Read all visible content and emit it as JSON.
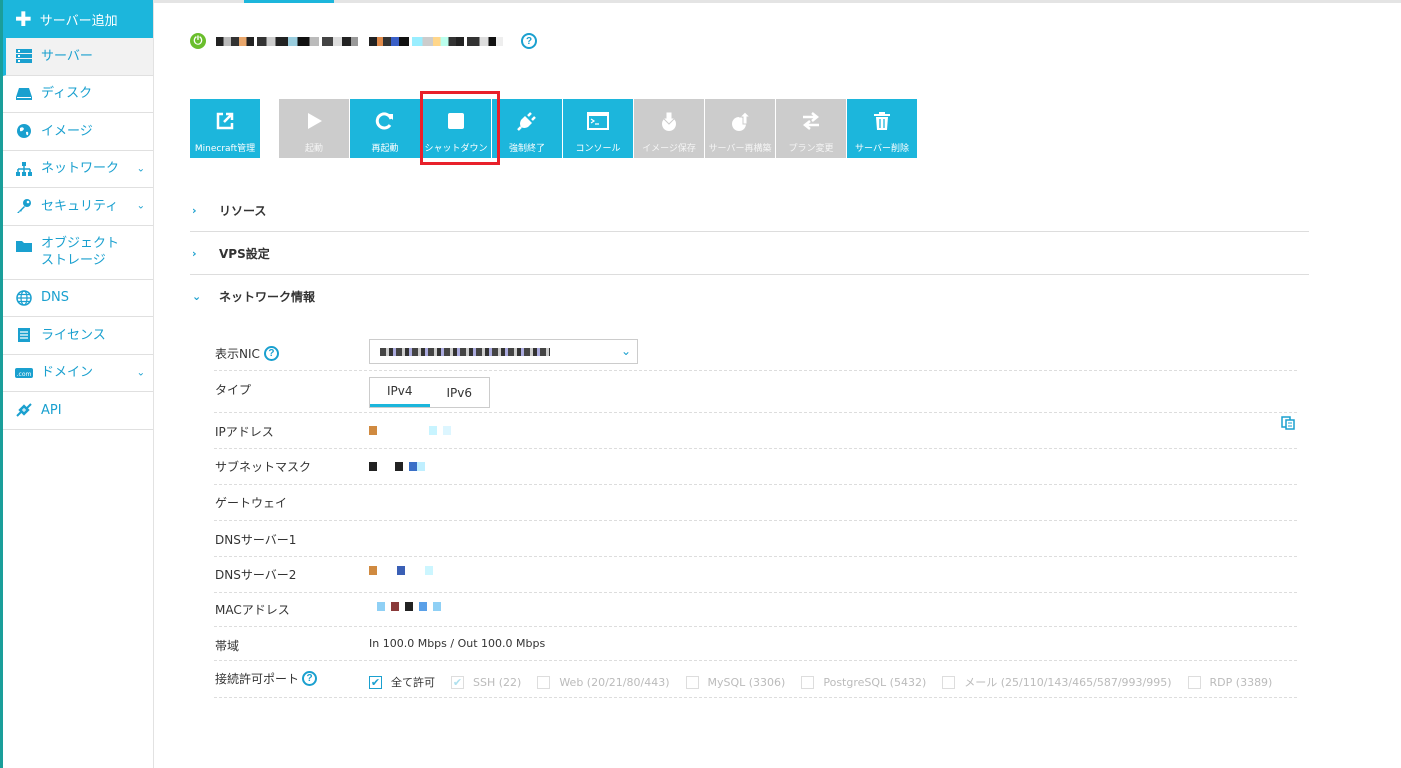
{
  "sidebar": {
    "add_server": "サーバー追加",
    "items": [
      {
        "label": "サーバー",
        "icon": "server-icon",
        "active": true
      },
      {
        "label": "ディスク",
        "icon": "disk-icon"
      },
      {
        "label": "イメージ",
        "icon": "globe-icon"
      },
      {
        "label": "ネットワーク",
        "icon": "network-icon",
        "expand": true
      },
      {
        "label": "セキュリティ",
        "icon": "key-icon",
        "expand": true
      },
      {
        "label": "オブジェクト\nストレージ",
        "icon": "folder-icon"
      },
      {
        "label": "DNS",
        "icon": "globe-icon"
      },
      {
        "label": "ライセンス",
        "icon": "document-icon"
      },
      {
        "label": "ドメイン",
        "icon": "com-icon",
        "expand": true
      },
      {
        "label": "API",
        "icon": "api-icon"
      }
    ]
  },
  "header": {
    "help": "?"
  },
  "toolbar": {
    "buttons": [
      {
        "label": "Minecraft管理",
        "icon": "external-link-icon",
        "enabled": true
      },
      {
        "label": "起動",
        "icon": "play-icon",
        "enabled": false
      },
      {
        "label": "再起動",
        "icon": "refresh-icon",
        "enabled": true
      },
      {
        "label": "シャットダウン",
        "icon": "stop-icon",
        "enabled": true
      },
      {
        "label": "強制終了",
        "icon": "plug-icon",
        "enabled": true
      },
      {
        "label": "コンソール",
        "icon": "console-icon",
        "enabled": true
      },
      {
        "label": "イメージ保存",
        "icon": "image-save-icon",
        "enabled": false
      },
      {
        "label": "サーバー再構築",
        "icon": "rebuild-icon",
        "enabled": false
      },
      {
        "label": "プラン変更",
        "icon": "swap-icon",
        "enabled": false
      },
      {
        "label": "サーバー削除",
        "icon": "trash-icon",
        "enabled": true
      }
    ]
  },
  "sections": {
    "resources": "リソース",
    "vps": "VPS設定",
    "network": "ネットワーク情報"
  },
  "network": {
    "nic_label": "表示NIC",
    "type_label": "タイプ",
    "tab_ipv4": "IPv4",
    "tab_ipv6": "IPv6",
    "ip_label": "IPアドレス",
    "subnet_label": "サブネットマスク",
    "gateway_label": "ゲートウェイ",
    "dns1_label": "DNSサーバー1",
    "dns2_label": "DNSサーバー2",
    "mac_label": "MACアドレス",
    "bandwidth_label": "帯域",
    "bandwidth_value": "In 100.0 Mbps / Out 100.0 Mbps",
    "ports_label": "接続許可ポート",
    "ports": {
      "all": "全て許可",
      "ssh": "SSH (22)",
      "web": "Web (20/21/80/443)",
      "mysql": "MySQL (3306)",
      "postgres": "PostgreSQL (5432)",
      "mail": "メール (25/110/143/465/587/993/995)",
      "rdp": "RDP (3389)"
    }
  },
  "colors": {
    "accent": "#1cb6dc",
    "link": "#1aa0cf",
    "disabled": "#cccccc",
    "highlight": "#e8202a",
    "power": "#6abe2c"
  }
}
